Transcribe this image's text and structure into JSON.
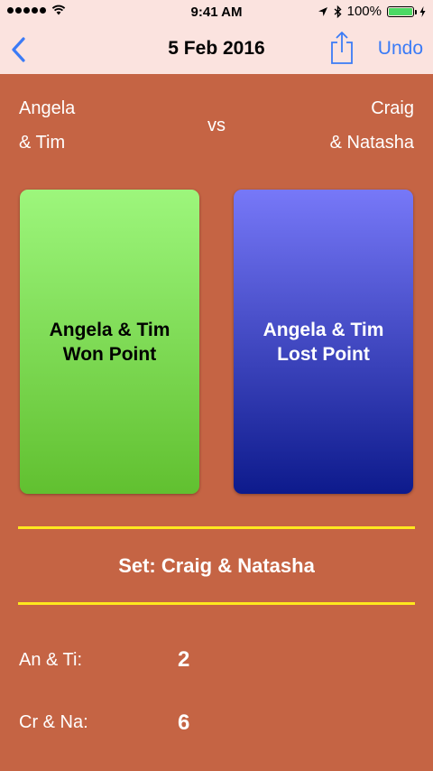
{
  "statusbar": {
    "time": "9:41 AM",
    "battery_text": "100%"
  },
  "navbar": {
    "title": "5 Feb 2016",
    "undo_label": "Undo"
  },
  "match": {
    "left_team": [
      "Angela",
      "& Tim"
    ],
    "vs_label": "vs",
    "right_team": [
      "Craig",
      "& Natasha"
    ]
  },
  "buttons": {
    "won": [
      "Angela & Tim",
      "Won Point"
    ],
    "lost": [
      "Angela & Tim",
      "Lost Point"
    ]
  },
  "set_label": "Set: Craig & Natasha",
  "scores": [
    {
      "name": "An & Ti:",
      "value": "2"
    },
    {
      "name": "Cr & Na:",
      "value": "6"
    }
  ],
  "colors": {
    "background": "#C56444",
    "bar_background": "#FBE3DF",
    "accent_blue": "#3B7BF6",
    "rule_yellow": "#FFE81E"
  },
  "icons": [
    "back-chevron-icon",
    "share-icon",
    "wifi-icon",
    "location-arrow-icon",
    "bluetooth-icon",
    "battery-icon",
    "charging-icon"
  ]
}
